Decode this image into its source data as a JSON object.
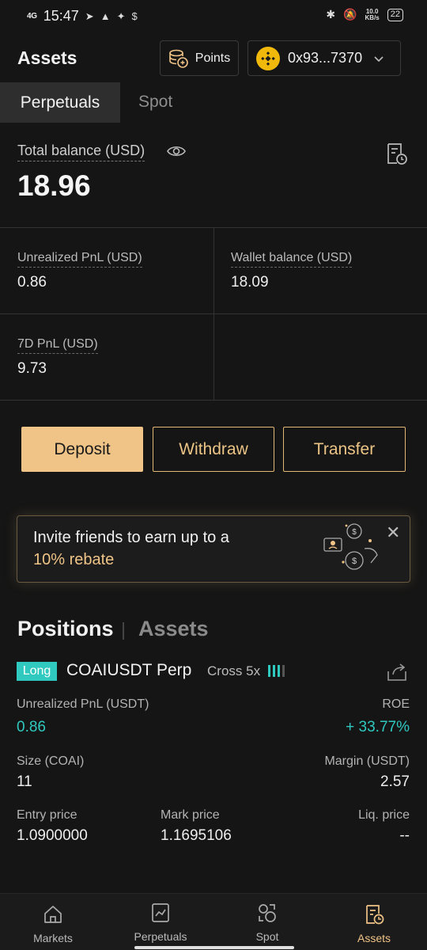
{
  "status_bar": {
    "network": "4G",
    "time": "15:47",
    "speed": "10.0\nKB/s",
    "battery": "22"
  },
  "header": {
    "title": "Assets",
    "points_label": "Points",
    "wallet_address": "0x93...7370"
  },
  "tabs": [
    {
      "label": "Perpetuals",
      "active": true
    },
    {
      "label": "Spot",
      "active": false
    }
  ],
  "balance": {
    "total_label": "Total balance (USD)",
    "total_value": "18.96"
  },
  "stats": {
    "unrealized_label": "Unrealized PnL (USD)",
    "unrealized_value": "0.86",
    "wallet_label": "Wallet balance (USD)",
    "wallet_value": "18.09",
    "pnl7d_label": "7D PnL (USD)",
    "pnl7d_value": "9.73"
  },
  "actions": {
    "deposit": "Deposit",
    "withdraw": "Withdraw",
    "transfer": "Transfer"
  },
  "banner": {
    "line1": "Invite friends to earn up to a",
    "line2": "10% rebate"
  },
  "sections": {
    "positions": "Positions",
    "assets": "Assets"
  },
  "position": {
    "side": "Long",
    "symbol": "COAIUSDT Perp",
    "mode": "Cross 5x",
    "leverage_level": 0.75,
    "unrealized_label": "Unrealized PnL (USDT)",
    "unrealized_value": "0.86",
    "roe_label": "ROE",
    "roe_value": "+ 33.77%",
    "size_label": "Size (COAI)",
    "size_value": "11",
    "margin_label": "Margin (USDT)",
    "margin_value": "2.57",
    "entry_label": "Entry price",
    "entry_value": "1.0900000",
    "mark_label": "Mark price",
    "mark_value": "1.1695106",
    "liq_label": "Liq. price",
    "liq_value": "--"
  },
  "bottom_nav": [
    {
      "label": "Markets",
      "icon": "home-icon"
    },
    {
      "label": "Perpetuals",
      "icon": "chart-icon"
    },
    {
      "label": "Spot",
      "icon": "spot-icon"
    },
    {
      "label": "Assets",
      "icon": "assets-icon",
      "active": true
    }
  ],
  "colors": {
    "accent": "#f0c487",
    "long": "#2fc9c0",
    "background": "#151515"
  }
}
